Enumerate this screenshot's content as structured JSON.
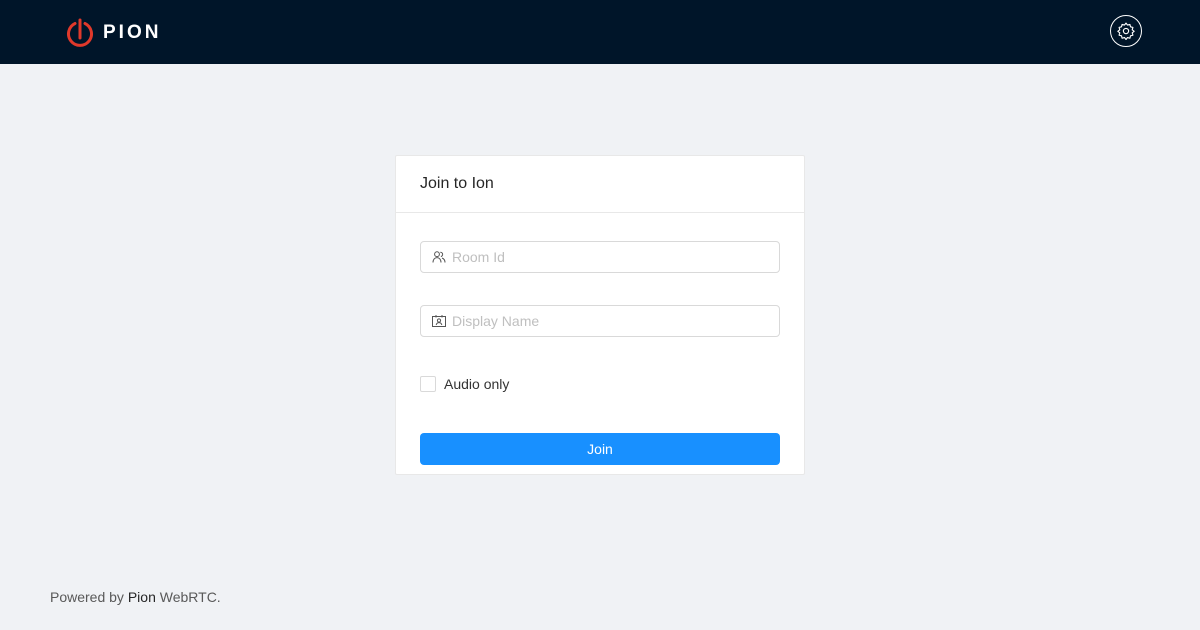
{
  "header": {
    "logo_text": "PION",
    "settings_icon": "gear-icon"
  },
  "colors": {
    "header_bg": "#001529",
    "brand_red": "#e0392b",
    "primary": "#1890ff",
    "page_bg": "#f0f2f5"
  },
  "card": {
    "title": "Join to Ion",
    "room_field": {
      "icon": "team-icon",
      "placeholder": "Room Id",
      "value": ""
    },
    "name_field": {
      "icon": "contacts-icon",
      "placeholder": "Display Name",
      "value": ""
    },
    "audio_only": {
      "label": "Audio only",
      "checked": false
    },
    "join_label": "Join"
  },
  "footer": {
    "prefix": "Powered by",
    "brand": "Pion",
    "suffix": "WebRTC."
  }
}
